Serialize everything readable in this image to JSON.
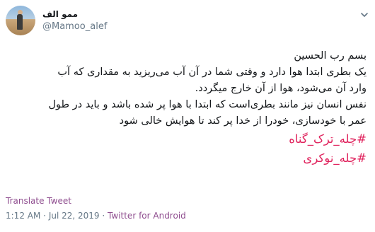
{
  "user": {
    "display_name": "ممو الف",
    "handle": "@Mamoo_alef"
  },
  "tweet": {
    "lines": [
      "بسم رب الحسین",
      "یک بطری ابتدا هوا دارد و وقتی شما در آن آب می‌ریزید به مقداری که آب",
      "وارد آن می‌شود، هوا از آن خارج میگردد.",
      "نفس انسان نیز مانند بطری‌است که ابتدا با هوا پر شده باشد و باید در طول",
      "عمر با خودسازی، خودرا از خدا پر کند تا هوایش خالی شود"
    ],
    "hashtags": [
      "#چله_ترک_گناه",
      "#چله_نوکری"
    ]
  },
  "translate_label": "Translate Tweet",
  "meta": {
    "time": "1:12 AM",
    "separator": "·",
    "date": "Jul 22, 2019",
    "source": "Twitter for Android"
  },
  "colors": {
    "hashtag": "#e0245e",
    "link": "#8e4c8e",
    "muted": "#657786"
  },
  "icons": {
    "chevron": "chevron-down-icon"
  }
}
